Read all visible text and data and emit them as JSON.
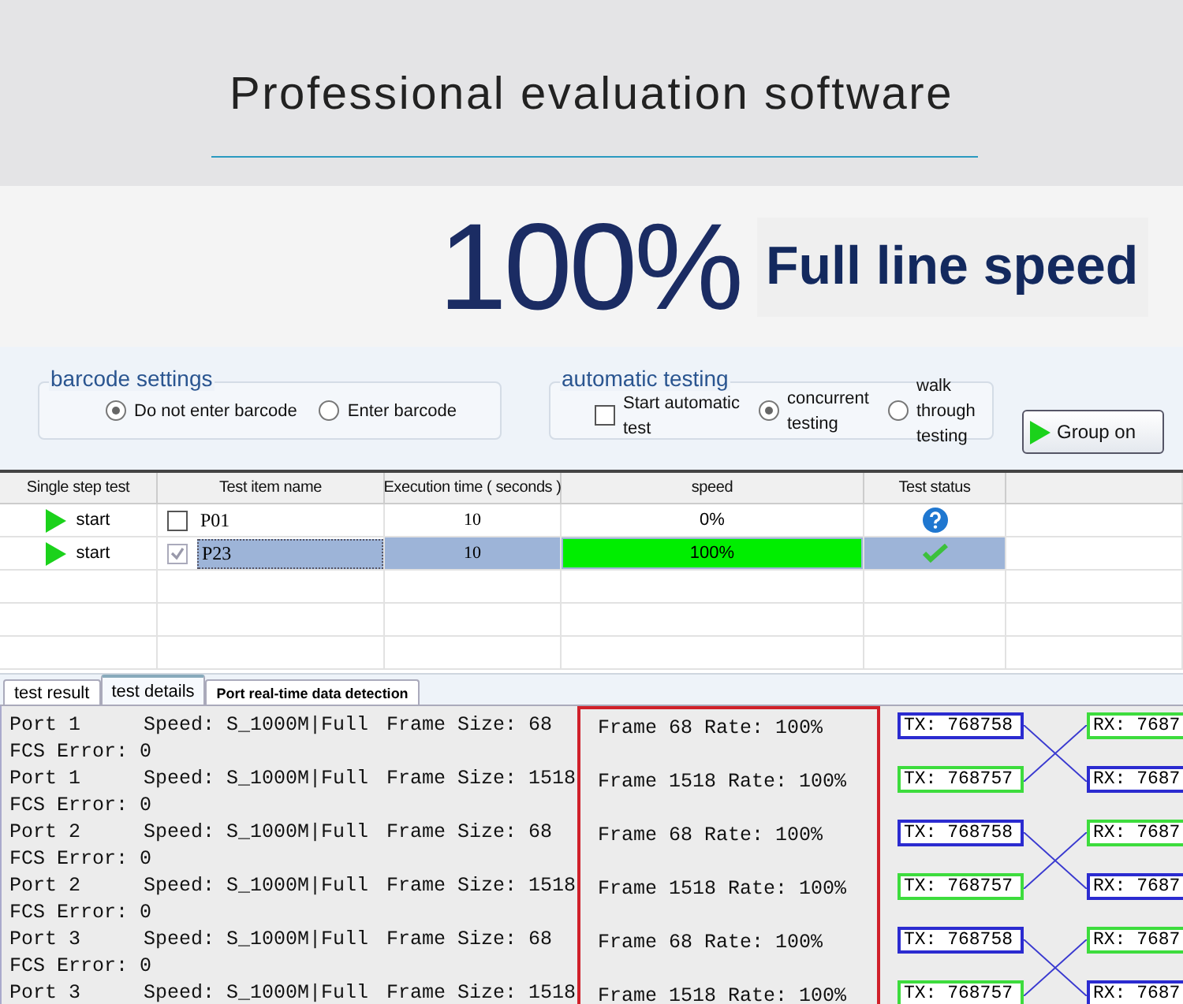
{
  "header": {
    "title": "Professional evaluation software"
  },
  "banner": {
    "figure": "100%",
    "caption": "Full line speed"
  },
  "barcode_settings": {
    "title": "barcode settings",
    "options": [
      {
        "label": "Do not enter barcode",
        "selected": true
      },
      {
        "label": "Enter barcode",
        "selected": false
      }
    ]
  },
  "automatic_testing": {
    "title": "automatic testing",
    "start": {
      "label": "Start automatic test",
      "checked": false
    },
    "modes": [
      {
        "label": "concurrent testing",
        "selected": true
      },
      {
        "label": "walk through testing",
        "selected": false
      }
    ]
  },
  "buttons": [
    {
      "label": "Group on"
    }
  ],
  "table": {
    "columns": [
      "Single step test",
      "Test item name",
      "Execution time ( seconds )",
      "speed",
      "Test status"
    ],
    "rows": [
      {
        "action": "start",
        "checked": false,
        "name": "P01",
        "time": "10",
        "speed": "0%",
        "kind": "unknown",
        "selected": false
      },
      {
        "action": "start",
        "checked": true,
        "name": "P23",
        "time": "10",
        "speed": "100%",
        "level": 1,
        "kind": "pass",
        "selected": true
      }
    ]
  },
  "tabs": [
    {
      "label": "test result",
      "selected": false
    },
    {
      "label": "test details",
      "selected": true
    },
    {
      "label": "Port real-time data detection",
      "selected": false
    }
  ],
  "details": [
    {
      "port": "Port 1",
      "speed": "Speed: S_1000M|Full",
      "frame": "Frame Size: 68",
      "fcs": "FCS Error: 0",
      "rate": "Frame 68 Rate: 100%",
      "tx": {
        "text": "TX: 768758",
        "color": "#2b2bd0"
      },
      "rx": {
        "text": "RX: 7687",
        "color": "#3ddc3d"
      }
    },
    {
      "port": "Port 1",
      "speed": "Speed: S_1000M|Full",
      "frame": "Frame Size: 1518",
      "fcs": "FCS Error: 0",
      "rate": "Frame 1518 Rate: 100%",
      "tx": {
        "text": "TX: 768757",
        "color": "#3ddc3d"
      },
      "rx": {
        "text": "RX: 7687",
        "color": "#2b2bd0"
      }
    },
    {
      "port": "Port 2",
      "speed": "Speed: S_1000M|Full",
      "frame": "Frame Size: 68",
      "fcs": "FCS Error: 0",
      "rate": "Frame 68 Rate: 100%",
      "tx": {
        "text": "TX: 768758",
        "color": "#2b2bd0"
      },
      "rx": {
        "text": "RX: 7687",
        "color": "#3ddc3d"
      }
    },
    {
      "port": "Port 2",
      "speed": "Speed: S_1000M|Full",
      "frame": "Frame Size: 1518",
      "fcs": "FCS Error: 0",
      "rate": "Frame 1518 Rate: 100%",
      "tx": {
        "text": "TX: 768757",
        "color": "#3ddc3d"
      },
      "rx": {
        "text": "RX: 7687",
        "color": "#2b2bd0"
      }
    },
    {
      "port": "Port 3",
      "speed": "Speed: S_1000M|Full",
      "frame": "Frame Size: 68",
      "fcs": "FCS Error: 0",
      "rate": "Frame 68 Rate: 100%",
      "tx": {
        "text": "TX: 768758",
        "color": "#2b2bd0"
      },
      "rx": {
        "text": "RX: 7687",
        "color": "#3ddc3d"
      }
    },
    {
      "port": "Port 3",
      "speed": "Speed: S_1000M|Full",
      "frame": "Frame Size: 1518",
      "rate": "Frame 1518 Rate: 100%",
      "tx": {
        "text": "TX: 768757",
        "color": "#3ddc3d"
      },
      "rx": {
        "text": "RX: 7687",
        "color": "#2b2bd0"
      }
    }
  ]
}
